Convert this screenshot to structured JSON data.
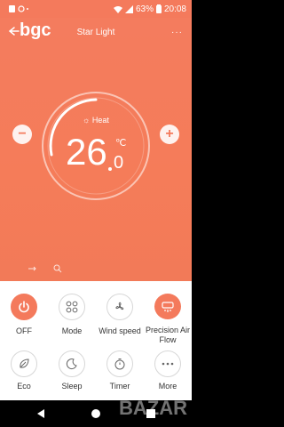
{
  "status_bar": {
    "time": "20:08",
    "battery": "63%"
  },
  "header": {
    "title": "Star Light",
    "more_label": "···"
  },
  "watermark": {
    "logo_text": "bgc",
    "bazar_text": "BAZAR"
  },
  "thermostat": {
    "mode_label": "Heat",
    "temperature_whole": "26",
    "temperature_decimal": "0",
    "unit": "℃",
    "decrease_label": "−",
    "increase_label": "+"
  },
  "controls": [
    {
      "label": "OFF",
      "icon": "power-icon",
      "active": true
    },
    {
      "label": "Mode",
      "icon": "mode-grid-icon",
      "active": false
    },
    {
      "label": "Wind speed",
      "icon": "fan-icon",
      "active": false
    },
    {
      "label": "Precision Air Flow",
      "icon": "airflow-icon",
      "active": true
    },
    {
      "label": "Eco",
      "icon": "leaf-icon",
      "active": false
    },
    {
      "label": "Sleep",
      "icon": "moon-icon",
      "active": false
    },
    {
      "label": "Timer",
      "icon": "timer-icon",
      "active": false
    },
    {
      "label": "More",
      "icon": "more-dots-icon",
      "active": false
    }
  ],
  "colors": {
    "accent": "#f47a5c",
    "panel_bg": "#ffffff",
    "text_dark": "#333333"
  }
}
